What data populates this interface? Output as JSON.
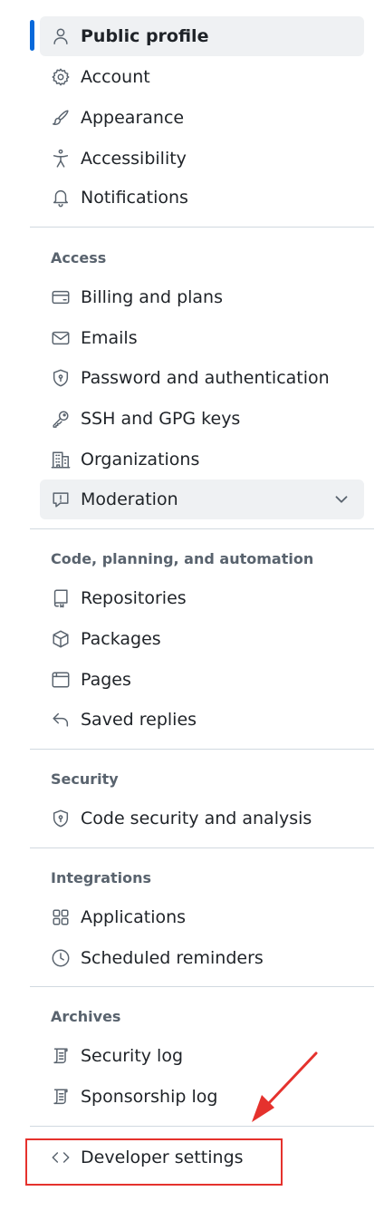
{
  "colors": {
    "accent": "#0969da",
    "annotation": "#e5322d",
    "active_bg": "#eff1f3"
  },
  "nav": {
    "top_items": [
      {
        "label": "Public profile",
        "icon": "person-icon"
      },
      {
        "label": "Account",
        "icon": "gear-icon"
      },
      {
        "label": "Appearance",
        "icon": "paintbrush-icon"
      },
      {
        "label": "Accessibility",
        "icon": "accessibility-icon"
      },
      {
        "label": "Notifications",
        "icon": "bell-icon"
      }
    ],
    "sections": [
      {
        "heading": "Access",
        "items": [
          {
            "label": "Billing and plans",
            "icon": "credit-card-icon"
          },
          {
            "label": "Emails",
            "icon": "mail-icon"
          },
          {
            "label": "Password and authentication",
            "icon": "shield-lock-icon"
          },
          {
            "label": "SSH and GPG keys",
            "icon": "key-icon"
          },
          {
            "label": "Organizations",
            "icon": "organization-icon"
          },
          {
            "label": "Moderation",
            "icon": "report-icon",
            "expandable": true
          }
        ]
      },
      {
        "heading": "Code, planning, and automation",
        "items": [
          {
            "label": "Repositories",
            "icon": "repo-icon"
          },
          {
            "label": "Packages",
            "icon": "package-icon"
          },
          {
            "label": "Pages",
            "icon": "browser-icon"
          },
          {
            "label": "Saved replies",
            "icon": "reply-icon"
          }
        ]
      },
      {
        "heading": "Security",
        "items": [
          {
            "label": "Code security and analysis",
            "icon": "shield-lock-icon"
          }
        ]
      },
      {
        "heading": "Integrations",
        "items": [
          {
            "label": "Applications",
            "icon": "apps-icon"
          },
          {
            "label": "Scheduled reminders",
            "icon": "clock-icon"
          }
        ]
      },
      {
        "heading": "Archives",
        "items": [
          {
            "label": "Security log",
            "icon": "log-icon"
          },
          {
            "label": "Sponsorship log",
            "icon": "log-icon"
          }
        ]
      }
    ],
    "bottom_item": {
      "label": "Developer settings",
      "icon": "code-icon"
    }
  }
}
